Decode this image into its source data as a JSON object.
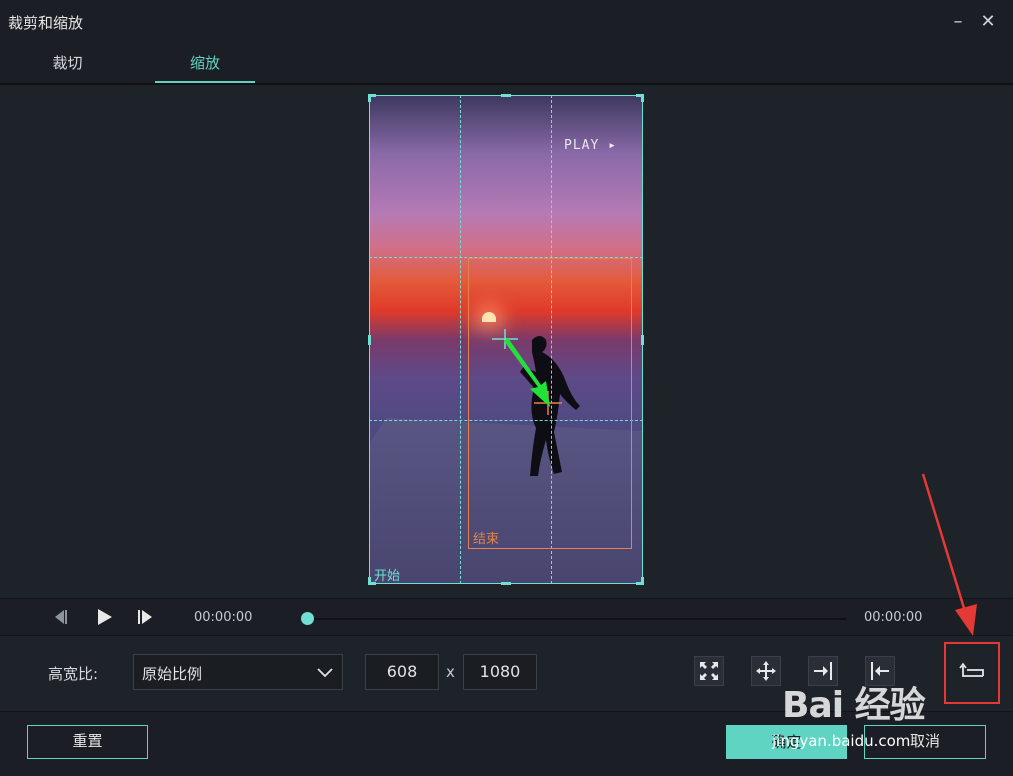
{
  "window": {
    "title": "裁剪和缩放",
    "minimize_glyph": "–",
    "close_glyph": "✕"
  },
  "tabs": [
    {
      "label": "裁切",
      "active": false
    },
    {
      "label": "缩放",
      "active": true
    }
  ],
  "preview": {
    "overlay_text": "PLAY ▸",
    "start_label": "开始",
    "end_label": "结束"
  },
  "playback": {
    "current_time": "00:00:00",
    "total_time": "00:00:00",
    "progress": 0,
    "prev_frame_icon": "prev-frame-icon",
    "play_icon": "play-icon",
    "next_frame_icon": "next-frame-icon"
  },
  "aspect": {
    "label": "高宽比:",
    "selected": "原始比例",
    "width": "608",
    "sep": "x",
    "height": "1080"
  },
  "tools": [
    {
      "icon": "fit-icon"
    },
    {
      "icon": "move-icon"
    },
    {
      "icon": "arrow-right-icon"
    },
    {
      "icon": "arrow-left-icon"
    },
    {
      "icon": "swap-icon"
    }
  ],
  "footer": {
    "reset_label": "重置",
    "ok_label": "确定",
    "cancel_label": "取消"
  },
  "watermark": {
    "brand": "Bai 经验",
    "url": "jingyan.baidu.com"
  },
  "colors": {
    "accent": "#5fd4c3",
    "end_frame": "#e3824a",
    "highlight": "#e53935",
    "bg": "#1e2229"
  }
}
